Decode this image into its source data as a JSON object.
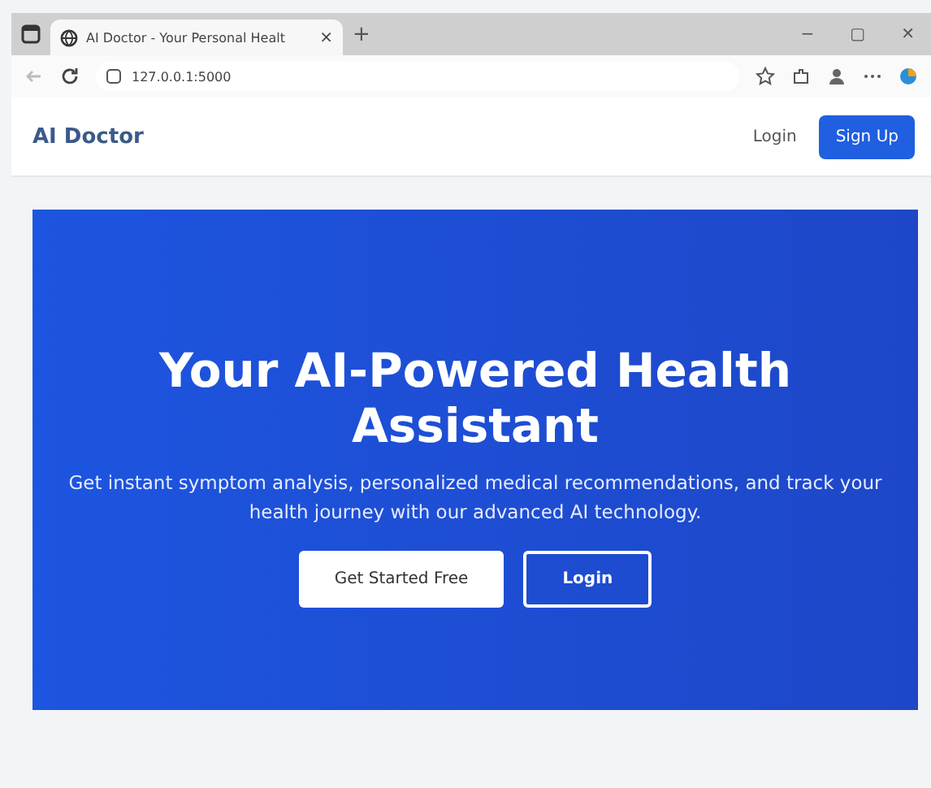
{
  "browser": {
    "tab_title": "AI Doctor - Your Personal Healt",
    "tab_close": "×",
    "new_tab": "+",
    "url": "127.0.0.1:5000",
    "window_controls": [
      "−",
      "▢",
      "✕"
    ]
  },
  "nav": {
    "brand": "AI Doctor",
    "login": "Login",
    "signup": "Sign Up"
  },
  "hero": {
    "title": "Your AI-Powered Health Assistant",
    "subtitle": "Get instant symptom analysis, personalized medical recommendations, and track your health journey with our advanced AI technology.",
    "primary_button": "Get Started Free",
    "secondary_button": "Login"
  }
}
